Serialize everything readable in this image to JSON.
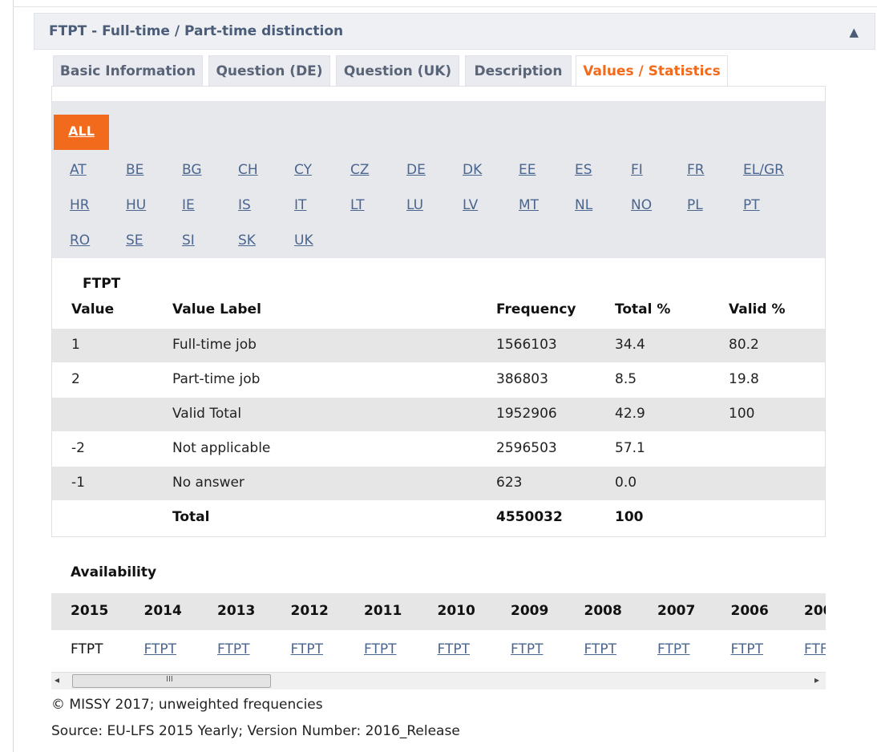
{
  "panel": {
    "title": "FTPT - Full-time / Part-time distinction",
    "collapse_icon": "▲"
  },
  "tabs": [
    {
      "label": "Basic Information"
    },
    {
      "label": "Question (DE)"
    },
    {
      "label": "Question (UK)"
    },
    {
      "label": "Description"
    },
    {
      "label": "Values / Statistics",
      "active": true
    }
  ],
  "countries": {
    "all_label": "ALL",
    "rows": [
      [
        "AT",
        "BE",
        "BG",
        "CH",
        "CY",
        "CZ",
        "DE",
        "DK",
        "EE",
        "ES",
        "FI",
        "FR",
        "EL/GR"
      ],
      [
        "HR",
        "HU",
        "IE",
        "IS",
        "IT",
        "LT",
        "LU",
        "LV",
        "MT",
        "NL",
        "NO",
        "PL",
        "PT"
      ],
      [
        "RO",
        "SE",
        "SI",
        "SK",
        "UK"
      ]
    ]
  },
  "stats": {
    "variable": "FTPT",
    "headers": {
      "value": "Value",
      "label": "Value Label",
      "frequency": "Frequency",
      "total": "Total %",
      "valid": "Valid %"
    },
    "rows": [
      {
        "value": "1",
        "label": "Full-time job",
        "frequency": "1566103",
        "total": "34.4",
        "valid": "80.2"
      },
      {
        "value": "2",
        "label": "Part-time job",
        "frequency": "386803",
        "total": "8.5",
        "valid": "19.8"
      },
      {
        "value": "",
        "label": "Valid Total",
        "frequency": "1952906",
        "total": "42.9",
        "valid": "100"
      },
      {
        "value": "-2",
        "label": "Not applicable",
        "frequency": "2596503",
        "total": "57.1",
        "valid": ""
      },
      {
        "value": "-1",
        "label": "No answer",
        "frequency": "623",
        "total": "0.0",
        "valid": ""
      },
      {
        "value": "",
        "label": "Total",
        "frequency": "4550032",
        "total": "100",
        "valid": ""
      }
    ]
  },
  "availability": {
    "title": "Availability",
    "years": [
      "2015",
      "2014",
      "2013",
      "2012",
      "2011",
      "2010",
      "2009",
      "2008",
      "2007",
      "2006",
      "200"
    ],
    "variables": [
      "FTPT",
      "FTPT",
      "FTPT",
      "FTPT",
      "FTPT",
      "FTPT",
      "FTPT",
      "FTPT",
      "FTPT",
      "FTPT",
      "FTF"
    ]
  },
  "scrollbar": {
    "left_arrow": "◂",
    "right_arrow": "▸",
    "grip": "III"
  },
  "footer": {
    "copyright": "© MISSY 2017; unweighted frequencies",
    "source": "Source: EU-LFS 2015 Yearly; Version Number: 2016_Release"
  },
  "colors": {
    "accent": "#f26a1b",
    "link": "#4a6590",
    "header_bg": "#eef0f4",
    "shade": "#e6e6e6"
  }
}
